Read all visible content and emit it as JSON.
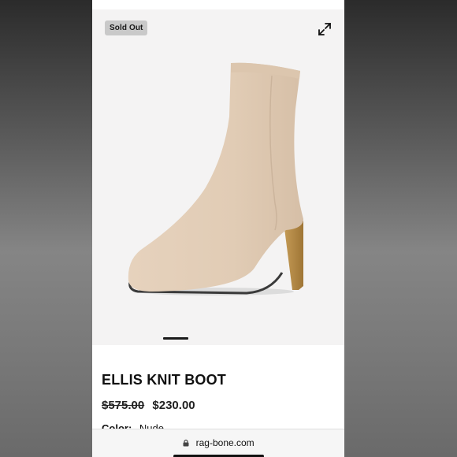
{
  "badge": {
    "label": "Sold Out"
  },
  "icons": {
    "expand": "expand-arrows-icon",
    "lock": "lock-icon"
  },
  "gallery": {
    "active_slide": 1
  },
  "product": {
    "title": "ELLIS KNIT BOOT",
    "original_price": "$575.00",
    "sale_price": "$230.00",
    "color_label": "Color:",
    "color_value": "Nude"
  },
  "browser": {
    "url": "rag-bone.com"
  },
  "colors": {
    "boot": "#e2cdb7",
    "heel": "#b88a44",
    "badge_bg": "#c9c9c9"
  }
}
